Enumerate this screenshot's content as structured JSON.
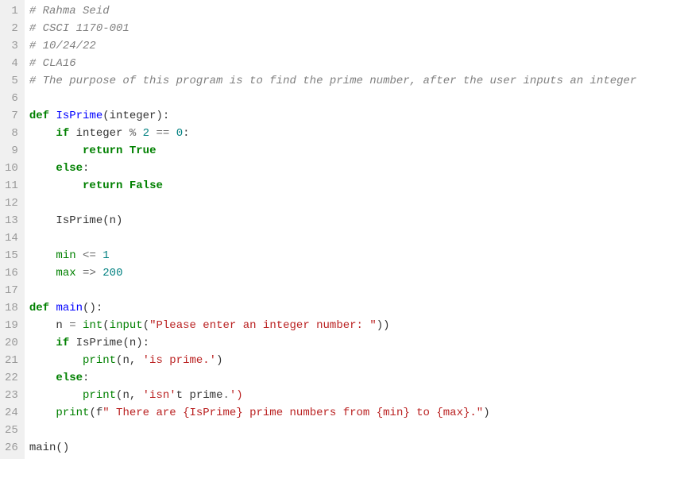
{
  "line_numbers": [
    "1",
    "2",
    "3",
    "4",
    "5",
    "6",
    "7",
    "8",
    "9",
    "10",
    "11",
    "12",
    "13",
    "14",
    "15",
    "16",
    "17",
    "18",
    "19",
    "20",
    "21",
    "22",
    "23",
    "24",
    "25",
    "26"
  ],
  "lines": [
    [
      {
        "t": "# Rahma Seid",
        "c": "comment"
      }
    ],
    [
      {
        "t": "# CSCI 1170-001",
        "c": "comment"
      }
    ],
    [
      {
        "t": "# 10/24/22",
        "c": "comment"
      }
    ],
    [
      {
        "t": "# CLA16",
        "c": "comment"
      }
    ],
    [
      {
        "t": "# The purpose of this program is to find the prime number, after the user inputs an integer",
        "c": "comment"
      }
    ],
    [],
    [
      {
        "t": "def",
        "c": "keyword"
      },
      {
        "t": " ",
        "c": "default"
      },
      {
        "t": "IsPrime",
        "c": "func"
      },
      {
        "t": "(integer):",
        "c": "default"
      }
    ],
    [
      {
        "t": "    ",
        "c": "default"
      },
      {
        "t": "if",
        "c": "keyword"
      },
      {
        "t": " integer ",
        "c": "default"
      },
      {
        "t": "%",
        "c": "op"
      },
      {
        "t": " ",
        "c": "default"
      },
      {
        "t": "2",
        "c": "number"
      },
      {
        "t": " ",
        "c": "default"
      },
      {
        "t": "==",
        "c": "op"
      },
      {
        "t": " ",
        "c": "default"
      },
      {
        "t": "0",
        "c": "number"
      },
      {
        "t": ":",
        "c": "default"
      }
    ],
    [
      {
        "t": "        ",
        "c": "default"
      },
      {
        "t": "return",
        "c": "keyword"
      },
      {
        "t": " ",
        "c": "default"
      },
      {
        "t": "True",
        "c": "keyword"
      }
    ],
    [
      {
        "t": "    ",
        "c": "default"
      },
      {
        "t": "else",
        "c": "keyword"
      },
      {
        "t": ":",
        "c": "default"
      }
    ],
    [
      {
        "t": "        ",
        "c": "default"
      },
      {
        "t": "return",
        "c": "keyword"
      },
      {
        "t": " ",
        "c": "default"
      },
      {
        "t": "False",
        "c": "keyword"
      }
    ],
    [],
    [
      {
        "t": "    IsPrime(n)",
        "c": "default"
      }
    ],
    [],
    [
      {
        "t": "    ",
        "c": "default"
      },
      {
        "t": "min",
        "c": "builtin"
      },
      {
        "t": " ",
        "c": "default"
      },
      {
        "t": "<=",
        "c": "op"
      },
      {
        "t": " ",
        "c": "default"
      },
      {
        "t": "1",
        "c": "number"
      }
    ],
    [
      {
        "t": "    ",
        "c": "default"
      },
      {
        "t": "max",
        "c": "builtin"
      },
      {
        "t": " ",
        "c": "default"
      },
      {
        "t": "=>",
        "c": "op"
      },
      {
        "t": " ",
        "c": "default"
      },
      {
        "t": "200",
        "c": "number"
      }
    ],
    [],
    [
      {
        "t": "def",
        "c": "keyword"
      },
      {
        "t": " ",
        "c": "default"
      },
      {
        "t": "main",
        "c": "func"
      },
      {
        "t": "():",
        "c": "default"
      }
    ],
    [
      {
        "t": "    n ",
        "c": "default"
      },
      {
        "t": "=",
        "c": "op"
      },
      {
        "t": " ",
        "c": "default"
      },
      {
        "t": "int",
        "c": "builtin"
      },
      {
        "t": "(",
        "c": "default"
      },
      {
        "t": "input",
        "c": "builtin"
      },
      {
        "t": "(",
        "c": "default"
      },
      {
        "t": "\"Please enter an integer number: \"",
        "c": "string"
      },
      {
        "t": "))",
        "c": "default"
      }
    ],
    [
      {
        "t": "    ",
        "c": "default"
      },
      {
        "t": "if",
        "c": "keyword"
      },
      {
        "t": " IsPrime(n):",
        "c": "default"
      }
    ],
    [
      {
        "t": "        ",
        "c": "default"
      },
      {
        "t": "print",
        "c": "builtin"
      },
      {
        "t": "(n, ",
        "c": "default"
      },
      {
        "t": "'is prime.'",
        "c": "string"
      },
      {
        "t": ")",
        "c": "default"
      }
    ],
    [
      {
        "t": "    ",
        "c": "default"
      },
      {
        "t": "else",
        "c": "keyword"
      },
      {
        "t": ":",
        "c": "default"
      }
    ],
    [
      {
        "t": "        ",
        "c": "default"
      },
      {
        "t": "print",
        "c": "builtin"
      },
      {
        "t": "(n, ",
        "c": "default"
      },
      {
        "t": "'isn'",
        "c": "string"
      },
      {
        "t": "t prime",
        "c": "default"
      },
      {
        "t": ".",
        "c": "op"
      },
      {
        "t": "')",
        "c": "string"
      }
    ],
    [
      {
        "t": "    ",
        "c": "default"
      },
      {
        "t": "print",
        "c": "builtin"
      },
      {
        "t": "(f",
        "c": "default"
      },
      {
        "t": "\" There are ",
        "c": "string"
      },
      {
        "t": "{IsPrime}",
        "c": "string"
      },
      {
        "t": " prime numbers from ",
        "c": "string"
      },
      {
        "t": "{min}",
        "c": "string"
      },
      {
        "t": " to ",
        "c": "string"
      },
      {
        "t": "{max}",
        "c": "string"
      },
      {
        "t": ".\"",
        "c": "string"
      },
      {
        "t": ")",
        "c": "default"
      }
    ],
    [],
    [
      {
        "t": "main()",
        "c": "default"
      }
    ]
  ]
}
